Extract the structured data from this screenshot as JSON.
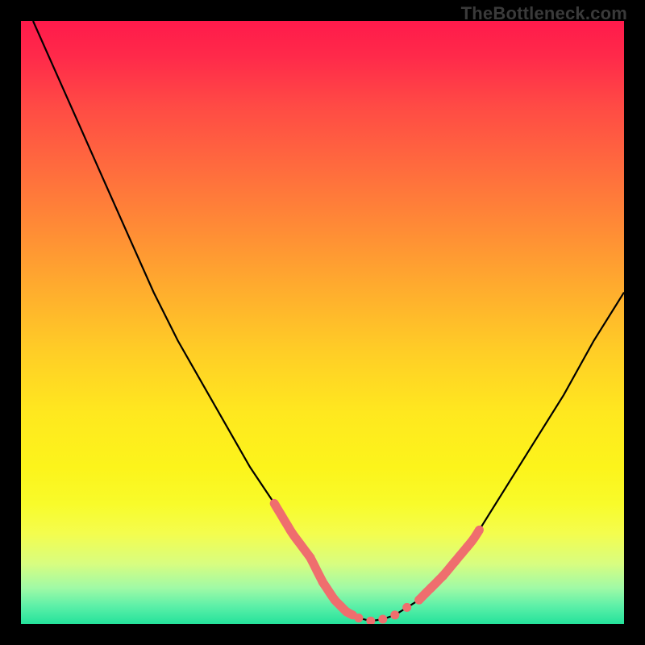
{
  "watermark": "TheBottleneck.com",
  "chart_data": {
    "type": "line",
    "title": "",
    "xlabel": "",
    "ylabel": "",
    "xlim": [
      0,
      100
    ],
    "ylim": [
      0,
      100
    ],
    "grid": false,
    "series": [
      {
        "name": "bottleneck-curve",
        "x": [
          2,
          6,
          10,
          14,
          18,
          22,
          26,
          30,
          34,
          38,
          42,
          45,
          48,
          50,
          52,
          54,
          56,
          58,
          60,
          62,
          66,
          70,
          75,
          80,
          85,
          90,
          95,
          100
        ],
        "y": [
          100,
          91,
          82,
          73,
          64,
          55,
          47,
          40,
          33,
          26,
          20,
          15,
          11,
          7,
          4,
          2,
          1,
          0.5,
          0.8,
          1.5,
          4,
          8,
          14,
          22,
          30,
          38,
          47,
          55
        ]
      }
    ],
    "highlight_segments": [
      {
        "name": "left-edge-highlight",
        "x": [
          42,
          55
        ],
        "color": "#ef6e6e"
      },
      {
        "name": "right-edge-highlight",
        "x": [
          66,
          76
        ],
        "color": "#ef6e6e"
      }
    ],
    "valley_dots": {
      "x": [
        48,
        50,
        52,
        54,
        56,
        58,
        60,
        62,
        64,
        66,
        68,
        70,
        72,
        74
      ],
      "color": "#ef6e6e"
    },
    "colors": {
      "curve": "#000000",
      "highlight": "#ef6e6e",
      "background_top": "#ff1a4b",
      "background_bottom": "#24e29b"
    }
  }
}
